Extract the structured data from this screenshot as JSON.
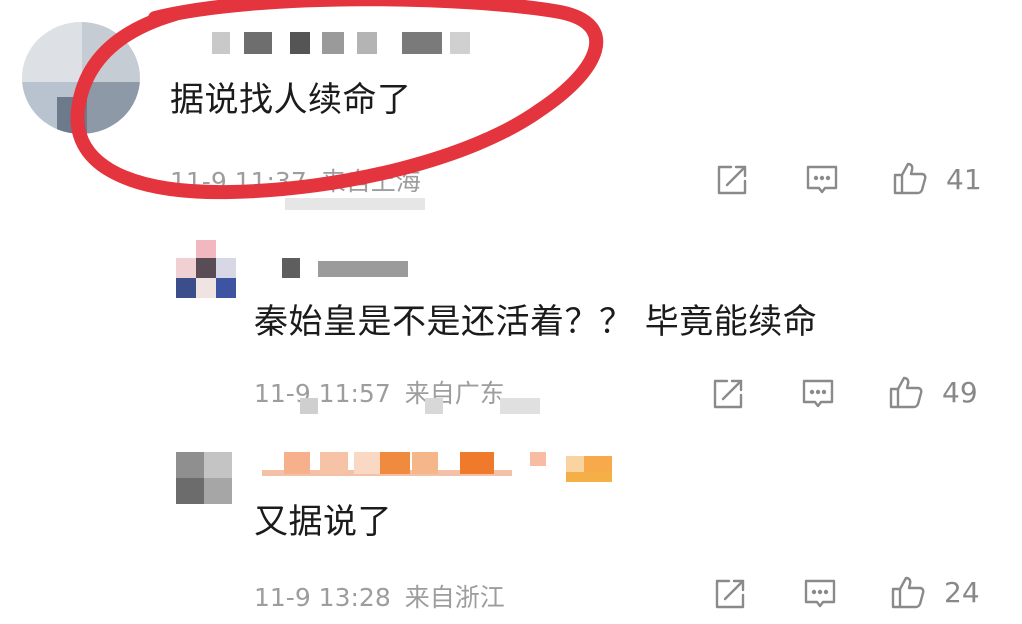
{
  "comments": [
    {
      "text": "据说找人续命了",
      "date": "11-9 11:37",
      "location": "来自上海",
      "likes": "41"
    },
    {
      "text": "秦始皇是不是还活着？？ 毕竟能续命",
      "date": "11-9 11:57",
      "location": "来自广东",
      "likes": "49"
    },
    {
      "text": "又据说了",
      "date": "11-9 13:28",
      "location": "来自浙江",
      "likes": "24"
    }
  ],
  "icons": {
    "share": "share-icon",
    "reply": "comment-icon",
    "like": "thumbs-up-icon"
  },
  "colors": {
    "annotation": "#e4343d",
    "meta_text": "#9d9d9d",
    "icon": "#8a8a8a"
  }
}
